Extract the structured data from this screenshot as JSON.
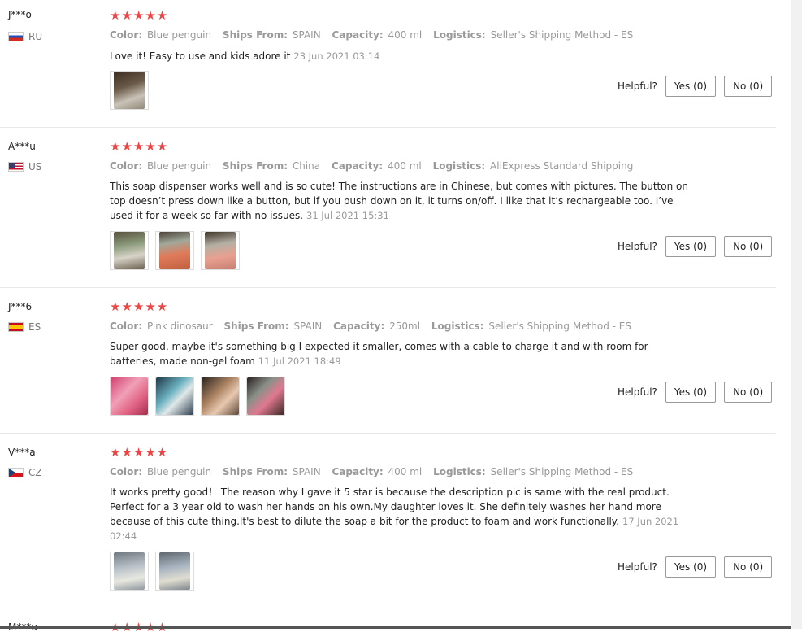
{
  "helpful_label": "Helpful?",
  "reviews": [
    {
      "user": "J***o",
      "country": "RU",
      "stars": "★★★★★",
      "color_label": "Color:",
      "color": "Blue penguin",
      "ships_label": "Ships From:",
      "ships": "SPAIN",
      "capacity_label": "Capacity:",
      "capacity": "400 ml",
      "logistics_label": "Logistics:",
      "logistics": "Seller's Shipping Method - ES",
      "text": "Love it! Easy to use and kids adore it",
      "date": "23 Jun 2021 03:14",
      "yes": "Yes (0)",
      "no": "No (0)"
    },
    {
      "user": "A***u",
      "country": "US",
      "stars": "★★★★★",
      "color_label": "Color:",
      "color": "Blue penguin",
      "ships_label": "Ships From:",
      "ships": "China",
      "capacity_label": "Capacity:",
      "capacity": "400 ml",
      "logistics_label": "Logistics:",
      "logistics": "AliExpress Standard Shipping",
      "text": "This soap dispenser works well and is so cute! The instructions are in Chinese, but comes with pictures. The button on top doesn’t press down like a button, but if you push down on it, it turns on/off. I like that it’s rechargeable too. I’ve used it for a week so far with no issues.",
      "date": "31 Jul 2021 15:31",
      "yes": "Yes (0)",
      "no": "No (0)"
    },
    {
      "user": "J***6",
      "country": "ES",
      "stars": "★★★★★",
      "color_label": "Color:",
      "color": "Pink dinosaur",
      "ships_label": "Ships From:",
      "ships": "SPAIN",
      "capacity_label": "Capacity:",
      "capacity": "250ml",
      "logistics_label": "Logistics:",
      "logistics": "Seller's Shipping Method - ES",
      "text": "Super good, maybe it's something big I expected it smaller, comes with a cable to charge it and with room for batteries, made non-gel foam",
      "date": "11 Jul 2021 18:49",
      "yes": "Yes (0)",
      "no": "No (0)"
    },
    {
      "user": "V***a",
      "country": "CZ",
      "stars": "★★★★★",
      "color_label": "Color:",
      "color": "Blue penguin",
      "ships_label": "Ships From:",
      "ships": "SPAIN",
      "capacity_label": "Capacity:",
      "capacity": "400 ml",
      "logistics_label": "Logistics:",
      "logistics": "Seller's Shipping Method - ES",
      "text": "It works pretty good！ The reason why I gave it 5 star is because the description pic is same with the real product. Perfect for a 3 year old to wash her hands on his own.My daughter loves it. She definitely washes her hand more because of this cute thing.It's best to dilute the soap a bit for the product to foam and work functionally.",
      "date": "17 Jun 2021 02:44",
      "yes": "Yes (0)",
      "no": "No (0)"
    },
    {
      "user": "M***u",
      "stars": "★★★★★"
    }
  ]
}
